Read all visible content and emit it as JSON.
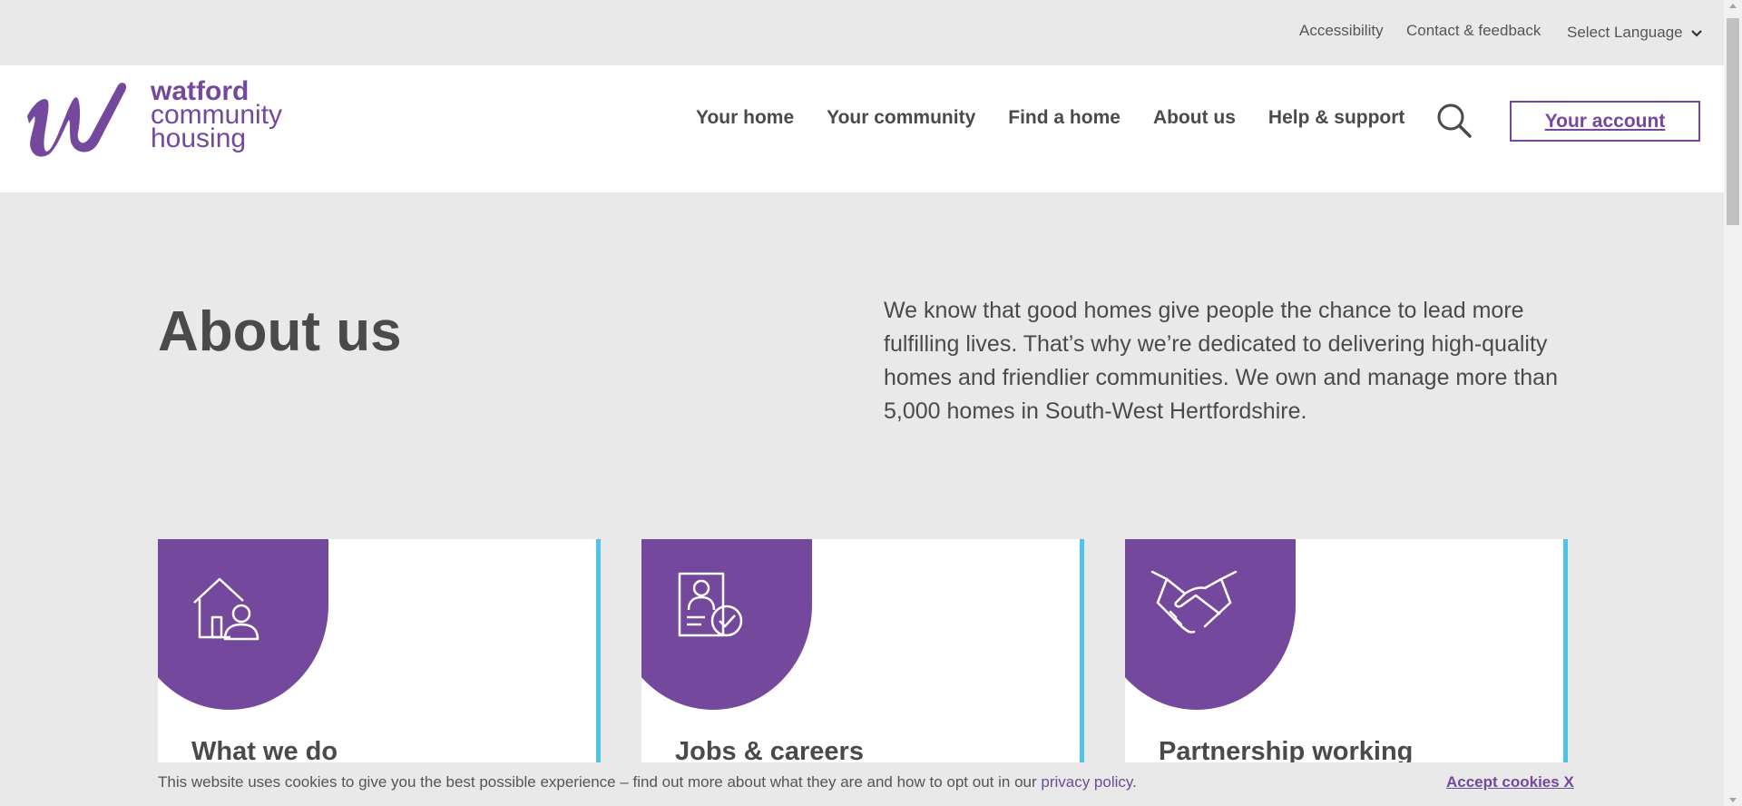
{
  "util_bar": {
    "accessibility": "Accessibility",
    "contact": "Contact & feedback",
    "language": "Select Language"
  },
  "logo": {
    "line1": "watford",
    "line2": "community",
    "line3": "housing",
    "color": "#74489d"
  },
  "nav": {
    "items": [
      "Your home",
      "Your community",
      "Find a home",
      "About us",
      "Help & support"
    ],
    "account": "Your account"
  },
  "hero": {
    "title": "About us",
    "intro": "We know that good homes give people the chance to lead more fulfilling lives. That’s why we’re dedicated to delivering high-quality homes and friendlier communities. We own and manage more than 5,000 homes in South-West Hertfordshire."
  },
  "cards": [
    {
      "title": "What we do",
      "icon": "house-person-icon"
    },
    {
      "title": "Jobs & careers",
      "icon": "document-check-icon"
    },
    {
      "title": "Partnership working",
      "icon": "handshake-icon"
    }
  ],
  "cookie": {
    "text": "This website uses cookies to give you the best possible experience – find out more about what they are and how to opt out in our ",
    "link": "privacy policy",
    "after": ".",
    "accept": "Accept cookies X"
  },
  "colors": {
    "brand_purple": "#74489d",
    "accent_blue": "#4fc3e8",
    "background": "#e9e9e9"
  }
}
